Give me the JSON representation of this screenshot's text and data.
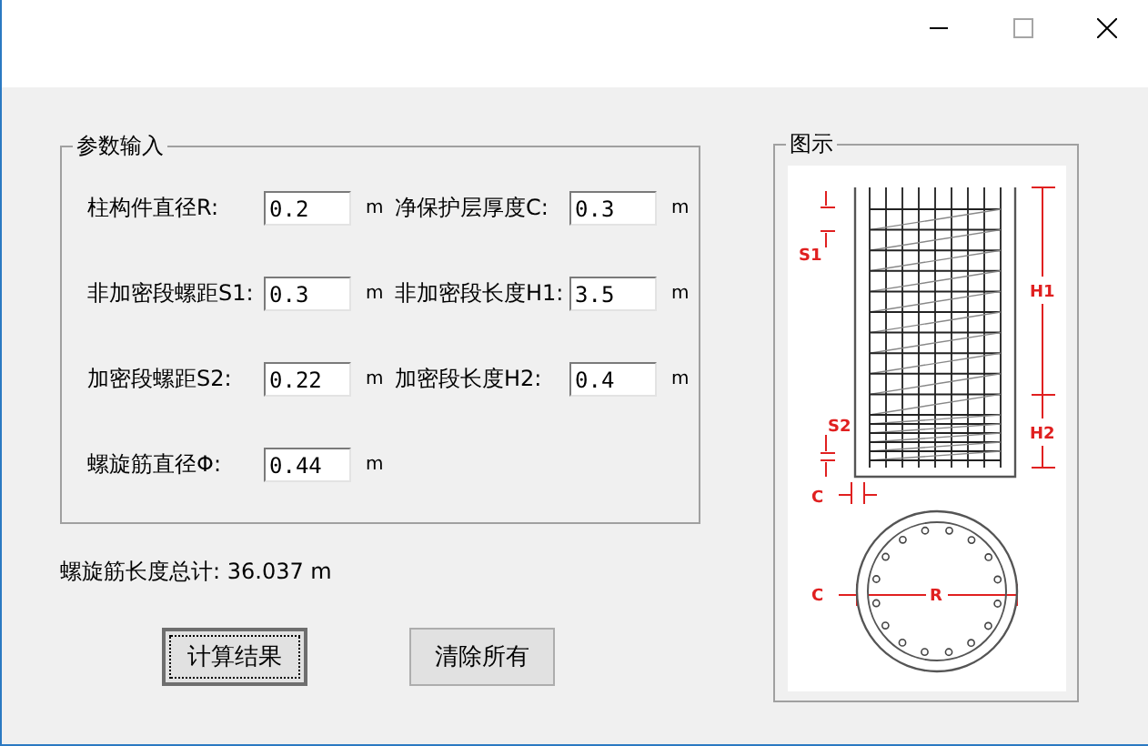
{
  "window": {
    "controls": [
      {
        "kind": "minimize"
      },
      {
        "kind": "maximize"
      },
      {
        "kind": "close"
      }
    ]
  },
  "parameters": {
    "title": "参数输入",
    "fields": [
      {
        "label": "柱构件直径R:",
        "value": "0.2",
        "unit": "m"
      },
      {
        "label": "净保护层厚度C:",
        "value": "0.3",
        "unit": "m"
      },
      {
        "label": "非加密段螺距S1:",
        "value": "0.3",
        "unit": "m"
      },
      {
        "label": "非加密段长度H1:",
        "value": "3.5",
        "unit": "m"
      },
      {
        "label": "加密段螺距S2:",
        "value": "0.22",
        "unit": "m"
      },
      {
        "label": "加密段长度H2:",
        "value": "0.4",
        "unit": "m"
      },
      {
        "label": "螺旋筋直径Φ:",
        "value": "0.44",
        "unit": "m"
      }
    ]
  },
  "result": "螺旋筋长度总计: 36.037 m",
  "buttons": [
    {
      "label": "计算结果",
      "default": true
    },
    {
      "label": "清除所有",
      "default": false
    }
  ],
  "diagram": {
    "title": "图示",
    "labels": [
      "S1",
      "H1",
      "S2",
      "H2",
      "C",
      "C",
      "R"
    ]
  }
}
